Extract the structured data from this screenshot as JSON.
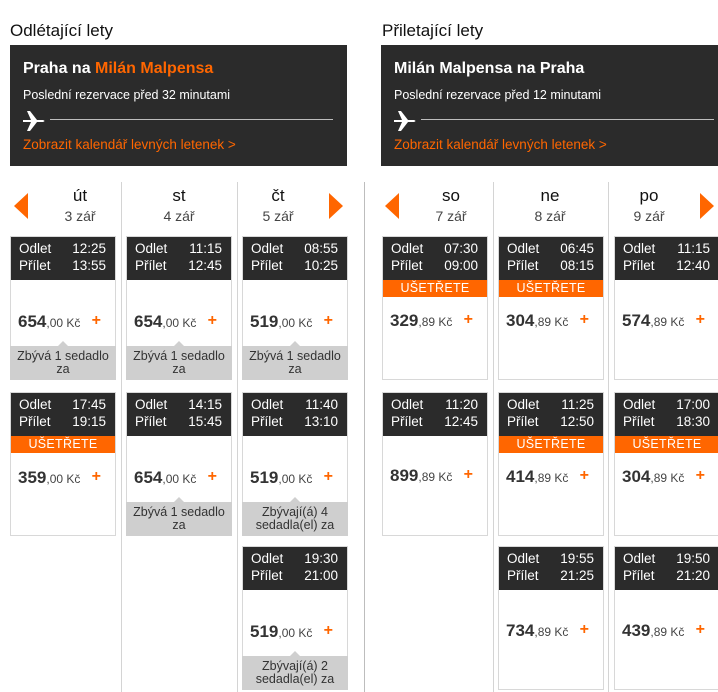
{
  "outbound": {
    "section_title": "Odlétající lety",
    "route_from": "Praha na ",
    "route_to": "Milán Malpensa",
    "last_booking": "Poslední rezervace před 32 minutami",
    "calendar_link": "Zobrazit kalendář levných letenek >",
    "days": [
      {
        "name": "út",
        "date": "3 zář"
      },
      {
        "name": "st",
        "date": "4 zář"
      },
      {
        "name": "čt",
        "date": "5 zář"
      }
    ],
    "flights": [
      [
        {
          "dep": "12:25",
          "arr": "13:55",
          "save": "",
          "price_int": "654",
          "price_dec": ",00 Kč",
          "seats": "Zbývá 1 sedadlo za"
        },
        {
          "dep": "17:45",
          "arr": "19:15",
          "save": "UŠETŘETE",
          "price_int": "359",
          "price_dec": ",00 Kč",
          "seats": ""
        }
      ],
      [
        {
          "dep": "11:15",
          "arr": "12:45",
          "save": "",
          "price_int": "654",
          "price_dec": ",00 Kč",
          "seats": "Zbývá 1 sedadlo za"
        },
        {
          "dep": "14:15",
          "arr": "15:45",
          "save": "",
          "price_int": "654",
          "price_dec": ",00 Kč",
          "seats": "Zbývá 1 sedadlo za"
        }
      ],
      [
        {
          "dep": "08:55",
          "arr": "10:25",
          "save": "",
          "price_int": "519",
          "price_dec": ",00 Kč",
          "seats": "Zbývá 1 sedadlo za"
        },
        {
          "dep": "11:40",
          "arr": "13:10",
          "save": "",
          "price_int": "519",
          "price_dec": ",00 Kč",
          "seats": "Zbývají(á) 4 sedadla(el) za"
        },
        {
          "dep": "19:30",
          "arr": "21:00",
          "save": "",
          "price_int": "519",
          "price_dec": ",00 Kč",
          "seats": "Zbývají(á) 2 sedadla(el) za"
        }
      ]
    ]
  },
  "inbound": {
    "section_title": "Přiletající lety",
    "route": "Milán Malpensa na Praha",
    "last_booking": "Poslední rezervace před 12 minutami",
    "calendar_link": "Zobrazit kalendář levných letenek >",
    "days": [
      {
        "name": "so",
        "date": "7 zář"
      },
      {
        "name": "ne",
        "date": "8 zář"
      },
      {
        "name": "po",
        "date": "9 zář"
      }
    ],
    "flights": [
      [
        {
          "dep": "07:30",
          "arr": "09:00",
          "save": "UŠETŘETE",
          "price_int": "329",
          "price_dec": ",89 Kč",
          "seats": ""
        },
        {
          "dep": "11:20",
          "arr": "12:45",
          "save": "",
          "price_int": "899",
          "price_dec": ",89 Kč",
          "seats": ""
        }
      ],
      [
        {
          "dep": "06:45",
          "arr": "08:15",
          "save": "UŠETŘETE",
          "price_int": "304",
          "price_dec": ",89 Kč",
          "seats": ""
        },
        {
          "dep": "11:25",
          "arr": "12:50",
          "save": "UŠETŘETE",
          "price_int": "414",
          "price_dec": ",89 Kč",
          "seats": ""
        },
        {
          "dep": "19:55",
          "arr": "21:25",
          "save": "",
          "price_int": "734",
          "price_dec": ",89 Kč",
          "seats": ""
        }
      ],
      [
        {
          "dep": "11:15",
          "arr": "12:40",
          "save": "",
          "price_int": "574",
          "price_dec": ",89 Kč",
          "seats": ""
        },
        {
          "dep": "17:00",
          "arr": "18:30",
          "save": "UŠETŘETE",
          "price_int": "304",
          "price_dec": ",89 Kč",
          "seats": ""
        },
        {
          "dep": "19:50",
          "arr": "21:20",
          "save": "",
          "price_int": "439",
          "price_dec": ",89 Kč",
          "seats": ""
        }
      ]
    ]
  },
  "labels": {
    "dep": "Odlet",
    "arr": "Přílet",
    "plus": "+"
  },
  "colors": {
    "accent": "#ff6600",
    "dark": "#2b2b2b",
    "seats_bg": "#cfcfcf"
  },
  "icons": {
    "plane": "plane-icon",
    "prev": "arrow-left-icon",
    "next": "arrow-right-icon"
  }
}
